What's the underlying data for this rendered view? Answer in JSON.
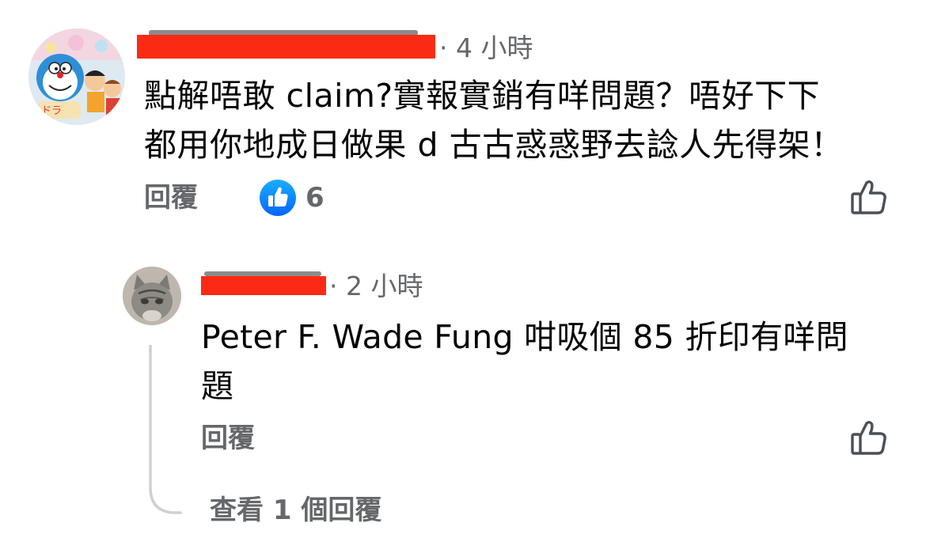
{
  "comments": [
    {
      "time": "· 4 小時",
      "body_lines": [
        "點解唔敢 claim?實報實銷有咩問題？唔好下下",
        "都用你地成日做果 d 古古惑惑野去諗人先得架！"
      ],
      "reply_label": "回覆",
      "reaction_count": "6"
    },
    {
      "time": "· 2 小時",
      "body_lines": [
        "Peter F. Wade Fung 咁吸個 85 折印有咩問",
        "題"
      ],
      "reply_label": "回覆"
    }
  ],
  "view_replies_label": "查看 1 個回覆",
  "colors": {
    "text": "#050505",
    "secondary": "#65676b",
    "like_blue": "#1877f2",
    "redaction": "#fb2a15",
    "thread_line": "#ced0d4"
  },
  "icons": {
    "reaction": "thumbs-up-badge-icon",
    "like": "thumbs-up-outline-icon"
  }
}
